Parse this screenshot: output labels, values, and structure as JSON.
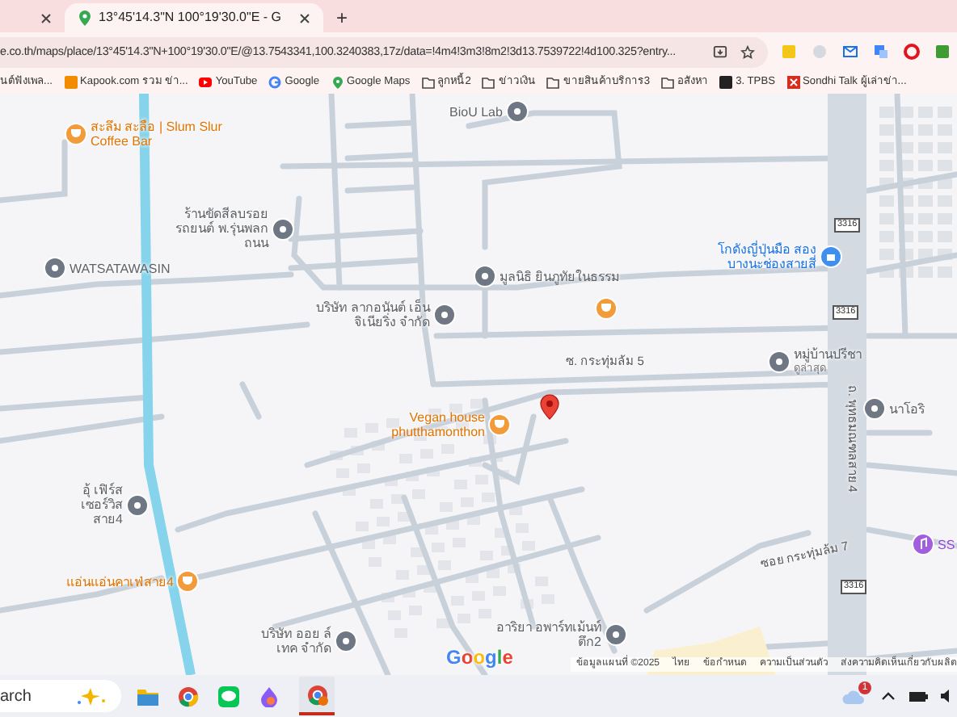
{
  "tabs": [
    {
      "selected": false
    },
    {
      "title": "13°45'14.3\"N 100°19'30.0\"E - G",
      "selected": true
    }
  ],
  "new_tab": "+",
  "address_bar": {
    "url": "e.co.th/maps/place/13°45'14.3\"N+100°19'30.0\"E/@13.7543341,100.3240383,17z/data=!4m4!3m3!8m2!3d13.7539722!4d100.325?entry..."
  },
  "bookmarks": [
    {
      "label": "นต์ฟังเพล...",
      "kind": "page"
    },
    {
      "label": "Kapook.com รวม ข่า...",
      "kind": "kapook"
    },
    {
      "label": "YouTube",
      "kind": "youtube"
    },
    {
      "label": "Google",
      "kind": "google"
    },
    {
      "label": "Google Maps",
      "kind": "maps"
    },
    {
      "label": "ลูกหนี้2",
      "kind": "folder"
    },
    {
      "label": "ข่าวเงิน",
      "kind": "folder"
    },
    {
      "label": "ขายสินค้าบริการ3",
      "kind": "folder"
    },
    {
      "label": "อสังหา",
      "kind": "folder"
    },
    {
      "label": "3. TPBS",
      "kind": "tpbs"
    },
    {
      "label": "Sondhi Talk ผู้เล่าข่า...",
      "kind": "sondhi"
    }
  ],
  "map": {
    "places": [
      {
        "label": "สะลึม สะลือ | Slum Slur Coffee Bar",
        "kind": "food"
      },
      {
        "label": "BioU Lab",
        "kind": "place"
      },
      {
        "label": "ร้านขัดสีลบรอย รถยนต์ พ.รุ่นพลก ถนน",
        "kind": "place"
      },
      {
        "label": "WATSATAWASIN",
        "kind": "place"
      },
      {
        "label": "บริษัท ลากอนันต์ เอ็นจิเนียริ่ง จำกัด",
        "kind": "place"
      },
      {
        "label": "มูลนิธิ ยินภูทัยในธรรม",
        "kind": "place"
      },
      {
        "kind": "food"
      },
      {
        "label": "โกดังญี่ปุ่นมือ สอง บางนะช่องสายสี่",
        "kind": "shop"
      },
      {
        "label": "หมู่บ้านปรีชา",
        "sublabel": "ดูล่าสุด",
        "kind": "place"
      },
      {
        "label": "Vegan house phutthamonthon",
        "kind": "food"
      },
      {
        "label": "นาโอริ",
        "kind": "place"
      },
      {
        "label": "SS",
        "kind": "music"
      },
      {
        "label": "อุ้ เฟิร์ส เซอร์วิส สาย4",
        "kind": "place"
      },
      {
        "label": "แอ่นแอ่นคาเฟ่สาย4",
        "kind": "food"
      },
      {
        "label": "บริษัท ออย ล์ เทค จำกัด",
        "kind": "place"
      },
      {
        "label": "อาริยา อพาร์ทเม้นท์ตึก2",
        "kind": "place"
      }
    ],
    "road_labels": [
      "ซ. กระทุ่มล้ม 5",
      "ถ. พุทธมณฑลสาย 4",
      "ซอย กระทุ่มล้ม 7"
    ],
    "logo": "Google",
    "route_shields": [
      "3316",
      "3316",
      "3316"
    ],
    "attribution": [
      "ข้อมูลแผนที่ ©2025",
      "ไทย",
      "ข้อกำหนด",
      "ความเป็นส่วนตัว",
      "ส่งความคิดเห็นเกี่ยวกับผลิต"
    ]
  },
  "taskbar": {
    "search": "arch",
    "notification_count": "1"
  }
}
